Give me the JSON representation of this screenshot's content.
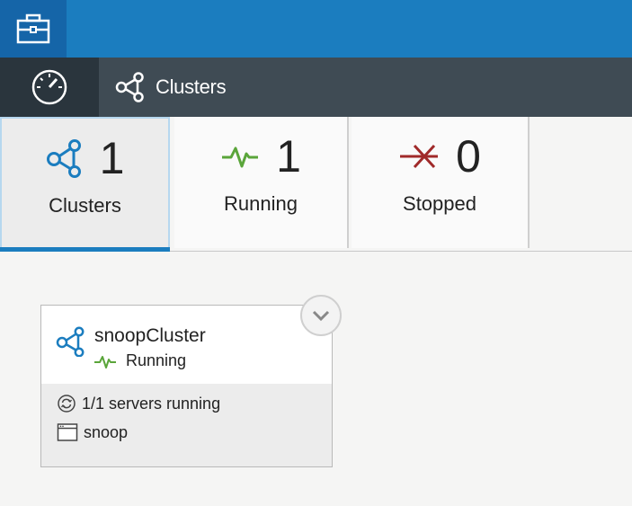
{
  "topbar": {
    "toolbox_icon": "toolbox-icon"
  },
  "nav": {
    "dashboard_icon": "speedometer-icon",
    "section_icon": "cluster-icon",
    "section_title": "Clusters"
  },
  "summary": {
    "clusters": {
      "count": "1",
      "label": "Clusters",
      "icon": "cluster-icon"
    },
    "running": {
      "count": "1",
      "label": "Running",
      "icon": "pulse-icon",
      "color": "#5aa53a"
    },
    "stopped": {
      "count": "0",
      "label": "Stopped",
      "icon": "stopped-arrow-icon",
      "color": "#a02a2a"
    },
    "accent": "#1b7dbf"
  },
  "card": {
    "name": "snoopCluster",
    "status": "Running",
    "servers": "1/1 servers running",
    "app": "snoop"
  }
}
